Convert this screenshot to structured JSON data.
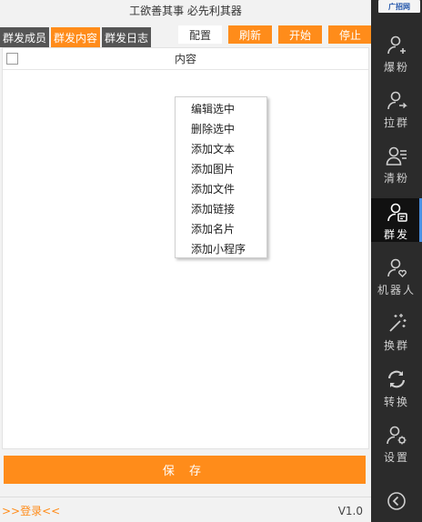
{
  "window": {
    "title": "工欲善其事 必先利其器"
  },
  "tabs": [
    {
      "label": "群发成员",
      "active": false
    },
    {
      "label": "群发内容",
      "active": true
    },
    {
      "label": "群发日志",
      "active": false
    }
  ],
  "toolbar": {
    "config_label": "配置",
    "refresh_label": "刷新",
    "start_label": "开始",
    "stop_label": "停止"
  },
  "table": {
    "header_content": "内容"
  },
  "context_menu": {
    "items": [
      "编辑选中",
      "删除选中",
      "添加文本",
      "添加图片",
      "添加文件",
      "添加链接",
      "添加名片",
      "添加小程序"
    ]
  },
  "save_button": {
    "label": "保 存"
  },
  "status_bar": {
    "login_link": ">>登录<<",
    "version": "V1.0"
  },
  "sidebar": {
    "logo_text": "广招网",
    "items": [
      {
        "label": "爆粉",
        "icon": "user-add-icon"
      },
      {
        "label": "拉群",
        "icon": "user-pull-icon"
      },
      {
        "label": "清粉",
        "icon": "user-list-icon"
      },
      {
        "label": "群发",
        "icon": "user-message-icon",
        "active": true
      },
      {
        "label": "机器人",
        "icon": "user-heart-icon"
      },
      {
        "label": "换群",
        "icon": "sparkle-icon"
      },
      {
        "label": "转换",
        "icon": "sync-icon"
      },
      {
        "label": "设置",
        "icon": "user-gear-icon"
      }
    ]
  },
  "colors": {
    "accent": "#ff8c1a",
    "sidebar_bg": "#2b2b2b",
    "active_indicator": "#4a90e2"
  }
}
